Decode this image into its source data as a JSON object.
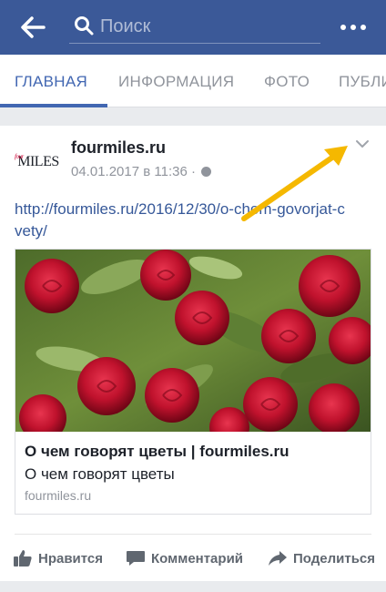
{
  "search": {
    "placeholder": "Поиск"
  },
  "tabs": [
    {
      "label": "ГЛАВНАЯ",
      "active": true
    },
    {
      "label": "ИНФОРМАЦИЯ",
      "active": false
    },
    {
      "label": "ФОТО",
      "active": false
    },
    {
      "label": "ПУБЛИ",
      "active": false
    }
  ],
  "post": {
    "avatar_text": "MILES",
    "author": "fourmiles.ru",
    "timestamp": "04.01.2017 в 11:36 ·",
    "link_text": "http://fourmiles.ru/2016/12/30/o-chem-govorjat-cvety/",
    "link_card": {
      "title": "О чем говорят цветы | fourmiles.ru",
      "description": "О чем говорят цветы",
      "domain": "fourmiles.ru"
    }
  },
  "actions": {
    "like": "Нравится",
    "comment": "Комментарий",
    "share": "Поделиться"
  },
  "colors": {
    "header": "#3b5998",
    "accent": "#4267b2",
    "link": "#365899",
    "annotation_arrow": "#f5b800"
  },
  "icons": {
    "back": "back-arrow-icon",
    "search": "search-icon",
    "more": "more-dots-icon",
    "chevron": "chevron-down-icon",
    "globe": "globe-icon",
    "like": "thumbs-up-icon",
    "comment": "comment-icon",
    "share": "share-icon"
  }
}
